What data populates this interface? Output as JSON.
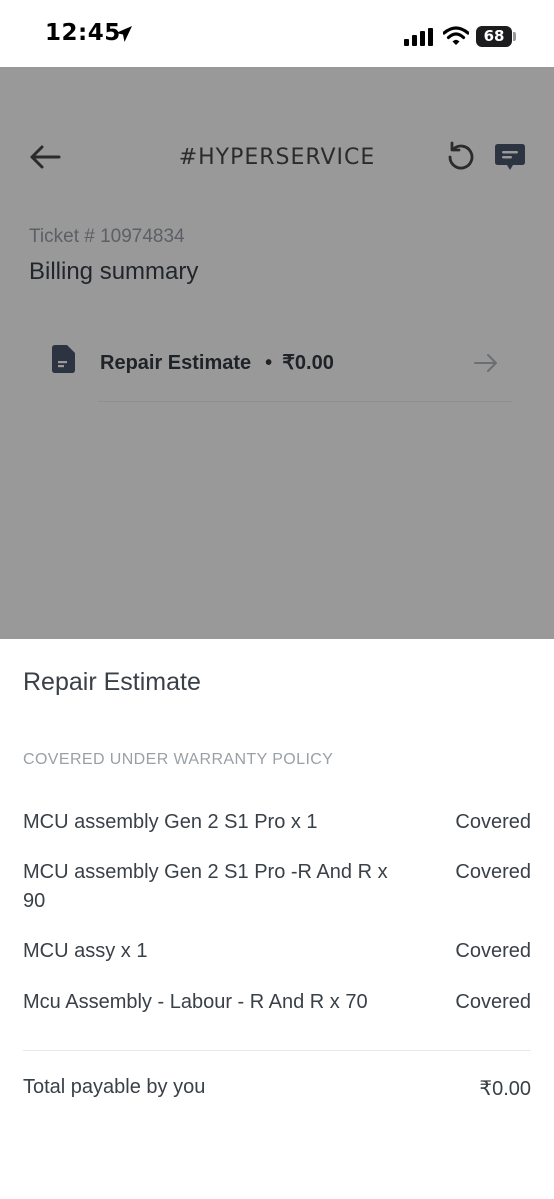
{
  "status_bar": {
    "time": "12:45",
    "battery": "68"
  },
  "header": {
    "title": "#HYPERSERVICE"
  },
  "ticket": {
    "label": "Ticket # 10974834",
    "title": "Billing summary"
  },
  "estimate_row": {
    "label": "Repair Estimate",
    "separator": "•",
    "amount": "₹0.00"
  },
  "sheet": {
    "title": "Repair Estimate",
    "section_label": "COVERED UNDER WARRANTY POLICY",
    "items": [
      {
        "name": "MCU assembly Gen 2 S1 Pro x 1",
        "status": "Covered"
      },
      {
        "name": "MCU assembly Gen 2 S1 Pro -R And R x 90",
        "status": "Covered"
      },
      {
        "name": "MCU assy x 1",
        "status": "Covered"
      },
      {
        "name": "Mcu Assembly - Labour - R And R x 70",
        "status": "Covered"
      }
    ],
    "total": {
      "label": "Total payable by you",
      "value": "₹0.00"
    }
  },
  "icons": [
    "location-arrow-icon",
    "cellular-signal-icon",
    "wifi-icon",
    "back-arrow-icon",
    "refresh-icon",
    "chat-icon",
    "document-icon",
    "right-arrow-icon"
  ]
}
